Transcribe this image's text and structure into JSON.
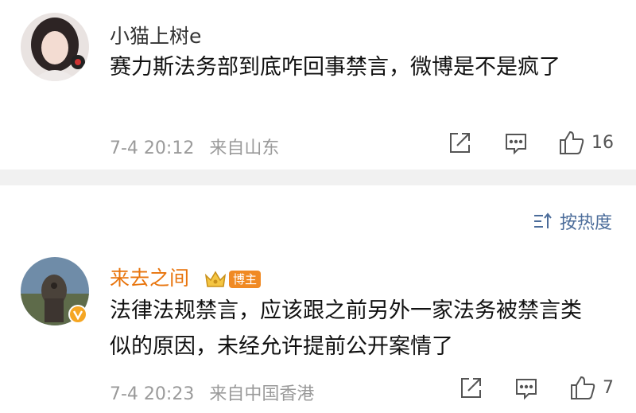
{
  "comments": [
    {
      "username": "小猫上树e",
      "text": "赛力斯法务部到底咋回事禁言，微博是不是疯了",
      "time": "7-4 20:12",
      "location": "来自山东",
      "likes": "16"
    },
    {
      "username": "来去之间",
      "badge": "博主",
      "text": "法律法规禁言，应该跟之前另外一家法务被禁言类似的原因，未经允许提前公开案情了",
      "time": "7-4 20:23",
      "location": "来自中国香港",
      "likes": "7"
    }
  ],
  "sort_label": "按热度",
  "colors": {
    "author_name": "#e8740c",
    "link_blue": "#4b6c9a",
    "meta_gray": "#9a9a9a",
    "badge_orange": "#f08a24",
    "divider": "#f1f1f1"
  },
  "icons": {
    "share": "share-icon",
    "comment": "comment-icon",
    "like": "thumbs-up-icon",
    "sort": "sort-icon",
    "crown": "crown-icon",
    "verified": "verified-v-icon"
  }
}
